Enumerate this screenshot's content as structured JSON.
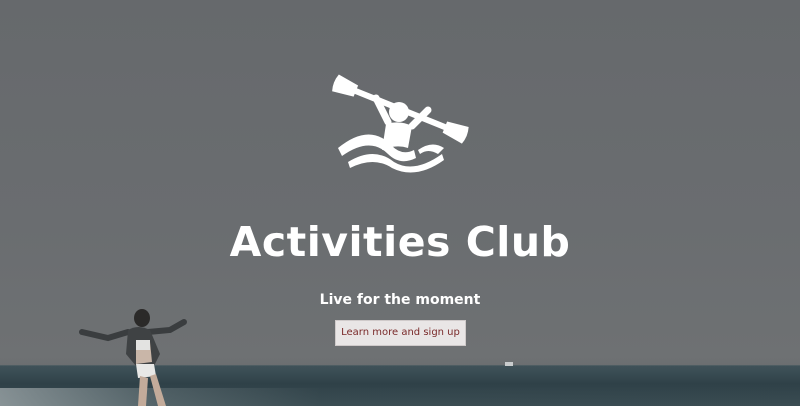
{
  "hero": {
    "title": "Activities Club",
    "tagline": "Live for the moment",
    "cta_label": "Learn more and sign up",
    "logo_icon": "kayaker-icon",
    "background_image": "person-running-on-beach-photo"
  },
  "colors": {
    "overlay": "#66696c",
    "title_text": "#ffffff",
    "button_bg": "#e9e6e6",
    "button_text": "#7a2a2a"
  }
}
